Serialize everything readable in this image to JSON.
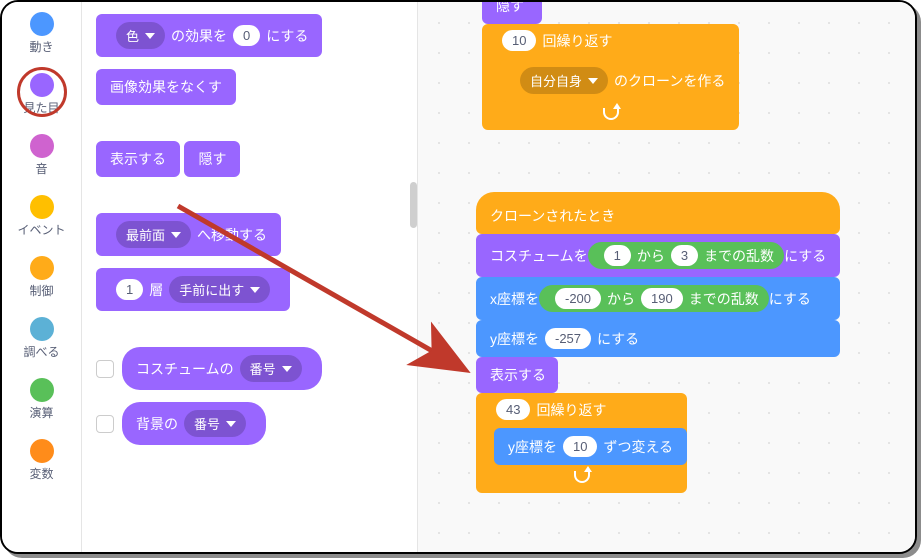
{
  "categories": [
    {
      "label": "動き",
      "color": "#4c97ff"
    },
    {
      "label": "見た目",
      "color": "#9966ff",
      "selected": true
    },
    {
      "label": "音",
      "color": "#cf63cf"
    },
    {
      "label": "イベント",
      "color": "#ffbf00"
    },
    {
      "label": "制御",
      "color": "#ffab19"
    },
    {
      "label": "調べる",
      "color": "#5cb1d6"
    },
    {
      "label": "演算",
      "color": "#59c059"
    },
    {
      "label": "変数",
      "color": "#ff8c1a"
    }
  ],
  "palette": {
    "setEffect": {
      "dd": "色",
      "value": "0",
      "prefix": "の効果を",
      "suffix": "にする"
    },
    "clearEffects": "画像効果をなくす",
    "show": "表示する",
    "hide": "隠す",
    "gotoLayer": {
      "dd": "最前面",
      "suffix": "へ移動する"
    },
    "changeLayer": {
      "value": "1",
      "mid": "層",
      "dd": "手前に出す"
    },
    "reporterCostume": {
      "label": "コスチュームの",
      "dd": "番号"
    },
    "reporterBackdrop": {
      "label": "背景の",
      "dd": "番号"
    }
  },
  "workspace": {
    "topHide": "隠す",
    "repeat1": {
      "count": "10",
      "label": "回繰り返す"
    },
    "createClone": {
      "dd": "自分自身",
      "suffix": "のクローンを作る"
    },
    "whenCloned": "クローンされたとき",
    "setCostume": {
      "prefix": "コスチュームを",
      "rand": {
        "from": "1",
        "mid": "から",
        "to": "3",
        "suffix": "までの乱数"
      },
      "suffix": "にする"
    },
    "setX": {
      "prefix": "x座標を",
      "rand": {
        "from": "-200",
        "mid": "から",
        "to": "190",
        "suffix": "までの乱数"
      },
      "suffix": "にする"
    },
    "setY": {
      "prefix": "y座標を",
      "value": "-257",
      "suffix": "にする"
    },
    "show": "表示する",
    "repeat2": {
      "count": "43",
      "label": "回繰り返す"
    },
    "changeY": {
      "prefix": "y座標を",
      "value": "10",
      "suffix": "ずつ変える"
    }
  }
}
